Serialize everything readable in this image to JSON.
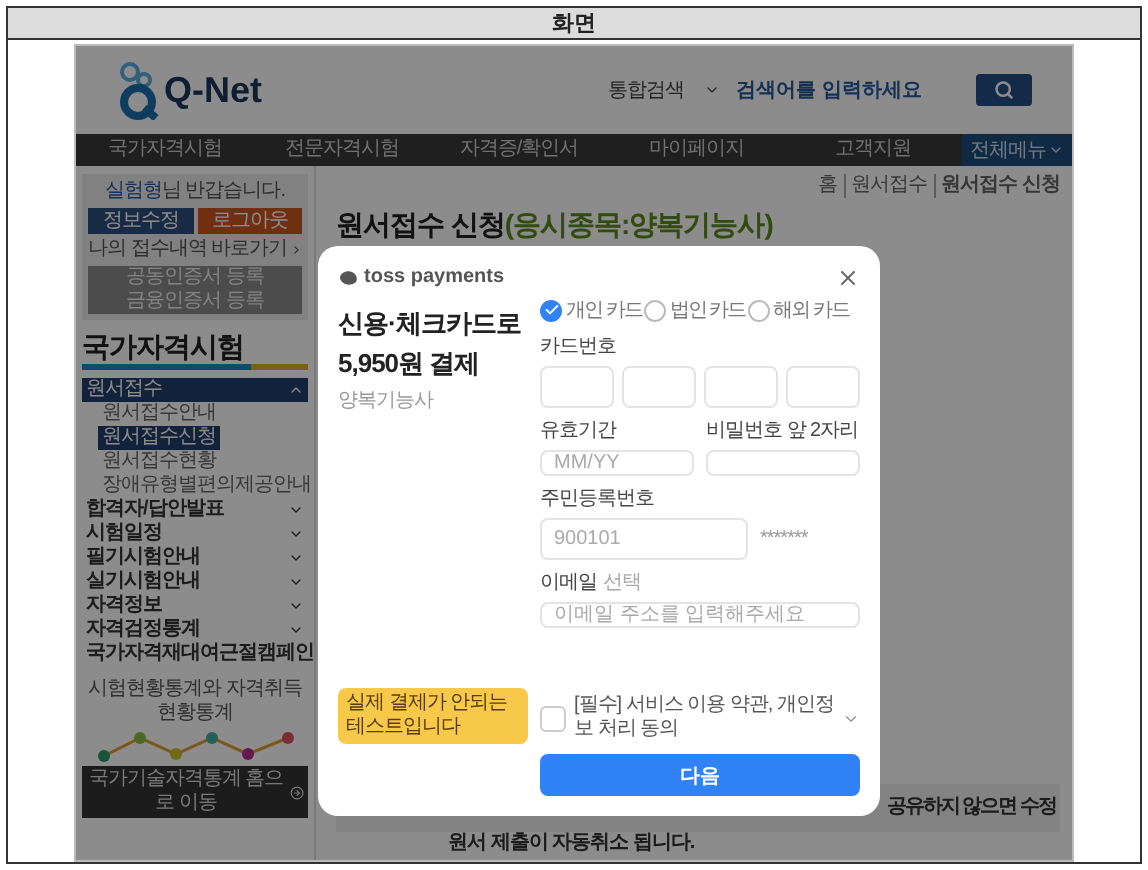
{
  "document": {
    "header": "화면"
  },
  "site": {
    "logo": "Q-Net",
    "search": {
      "scope": "통합검색",
      "placeholder": "검색어를 입력하세요"
    },
    "nav": [
      {
        "label": "국가자격시험"
      },
      {
        "label": "전문자격시험"
      },
      {
        "label": "자격증/확인서"
      },
      {
        "label": "마이페이지"
      },
      {
        "label": "고객지원"
      }
    ],
    "all_menu": "전체메뉴",
    "sidebar": {
      "user_name": "실험형",
      "greeting": "님 반갑습니다.",
      "buttons": [
        {
          "label": "정보수정",
          "kind": "primary"
        },
        {
          "label": "로그아웃",
          "kind": "accent"
        }
      ],
      "history_link": "나의 접수내역 바로가기",
      "cert_button": [
        "공동인증서 등록",
        "금융인증서 등록"
      ],
      "heading": "국가자격시험",
      "menu": [
        {
          "label": "원서접수",
          "expanded": true,
          "children": [
            {
              "label": "원서접수안내",
              "selected": false
            },
            {
              "label": "원서접수신청",
              "selected": true
            },
            {
              "label": "원서접수현황",
              "selected": false
            },
            {
              "label": "장애유형별편의제공안내",
              "selected": false
            }
          ]
        },
        {
          "label": "합격자/답안발표",
          "expanded": false
        },
        {
          "label": "시험일정",
          "expanded": false
        },
        {
          "label": "필기시험안내",
          "expanded": false
        },
        {
          "label": "실기시험안내",
          "expanded": false
        },
        {
          "label": "자격정보",
          "expanded": false
        },
        {
          "label": "자격검정통계",
          "expanded": false
        },
        {
          "label": "국가자격재대여근절캠페인",
          "expanded": false
        }
      ],
      "stats": {
        "caption": "시험현황통계와 자격취득현황통계",
        "button": "국가기술자격통계 홈으로 이동"
      }
    },
    "main": {
      "breadcrumb": [
        "홈",
        "원서접수",
        "원서접수 신청"
      ],
      "title": "원서접수 신청",
      "subtitle": "(응시종목:양복기능사)",
      "notice_right": "공유하지 않으면 수정",
      "notice_bottom": "원서 제출이 자동취소 됩니다."
    }
  },
  "payment_modal": {
    "brand": "toss payments",
    "title_lines": [
      "신용·체크카드로",
      "5,950원 결제"
    ],
    "product": "양복기능사",
    "test_badge": "실제 결제가 안되는 테스트입니다",
    "card_types": [
      {
        "label": "개인 카드",
        "selected": true
      },
      {
        "label": "법인 카드",
        "selected": false
      },
      {
        "label": "해외 카드",
        "selected": false
      }
    ],
    "card_number_label": "카드번호",
    "expiry": {
      "label": "유효기간",
      "placeholder": "MM/YY"
    },
    "password": {
      "label": "비밀번호 앞 2자리"
    },
    "resident_number": {
      "label": "주민등록번호",
      "placeholder": "900101",
      "masked": "*******"
    },
    "email": {
      "label": "이메일",
      "optional": "선택",
      "placeholder": "이메일 주소를 입력해주세요"
    },
    "agreement": {
      "label": "[필수] 서비스 이용 약관, 개인정보 처리 동의",
      "checked": false
    },
    "next_button": "다음"
  }
}
